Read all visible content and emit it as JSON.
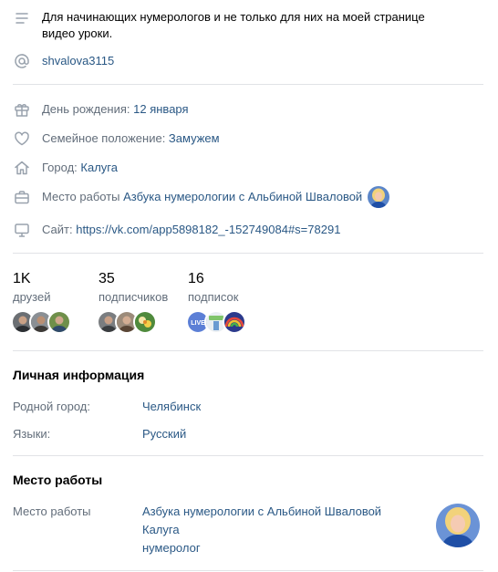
{
  "status": {
    "text": "Для начинающих нумерологов и не только для них на моей странице видео уроки.",
    "icon": "menu-lines-icon"
  },
  "short_address": {
    "icon": "at-icon",
    "value": "shvalova3115"
  },
  "details": [
    {
      "icon": "gift-icon",
      "label": "День рождения: ",
      "value": "12 января"
    },
    {
      "icon": "heart-icon",
      "label": "Семейное положение: ",
      "value": "Замужем"
    },
    {
      "icon": "home-icon",
      "label": "Город: ",
      "value": "Калуга"
    },
    {
      "icon": "briefcase-icon",
      "label": "Место работы ",
      "value": "Азбука нумерологии с Альбиной Швaловой"
    },
    {
      "icon": "monitor-icon",
      "label": "Сайт: ",
      "value": "https://vk.com/app5898182_-152749084#s=78291"
    }
  ],
  "counters": [
    {
      "count": "1K",
      "label": "друзей"
    },
    {
      "count": "35",
      "label": "подписчиков"
    },
    {
      "count": "16",
      "label": "подписок"
    }
  ],
  "subscription_badge": "LIVE",
  "personal": {
    "title": "Личная информация",
    "rows": [
      {
        "label": "Родной город:",
        "value": "Челябинск"
      },
      {
        "label": "Языки:",
        "value": "Русский"
      }
    ]
  },
  "career": {
    "title": "Место работы",
    "label": "Место работы",
    "company": "Азбука нумерологии с Альбиной Швaловой",
    "city": "Калуга",
    "position": "нумеролог"
  },
  "colors": {
    "link": "#2a5885",
    "muted": "#626d7a",
    "icon": "#99a2ad",
    "divider": "#e1e3e6"
  }
}
